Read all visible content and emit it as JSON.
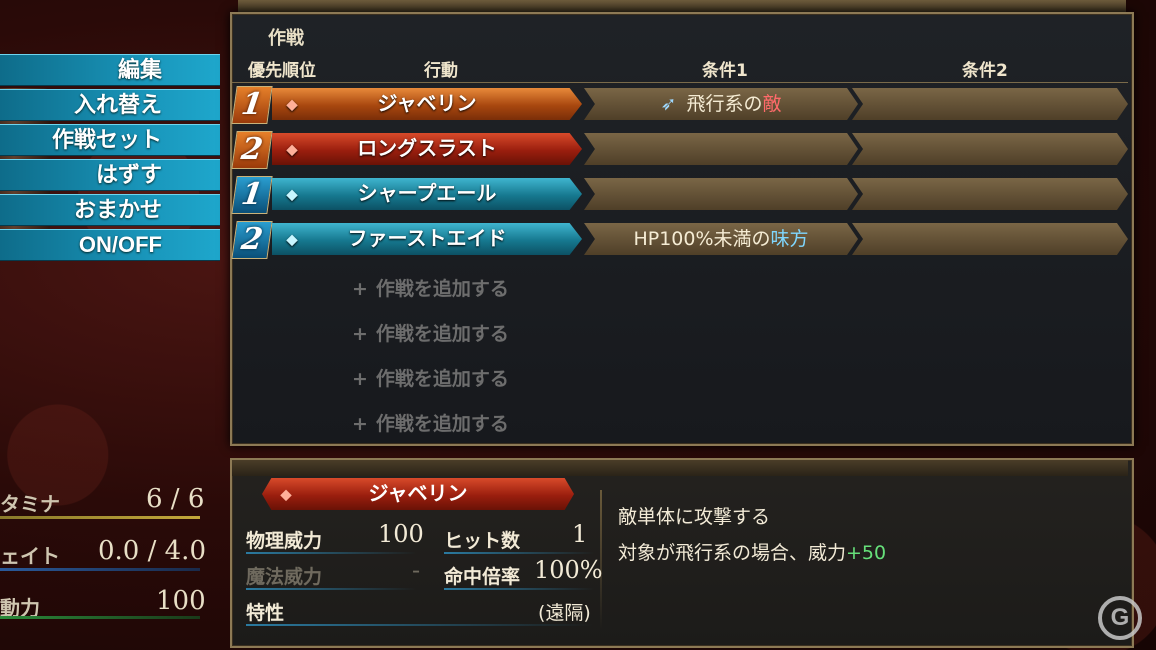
{
  "left_menu": [
    "編集",
    "入れ替え",
    "作戦セット",
    "はずす",
    "おまかせ",
    "ON/OFF"
  ],
  "panel": {
    "title": "作戦",
    "headers": {
      "priority": "優先順位",
      "action": "行動",
      "cond1": "条件1",
      "cond2": "条件2"
    }
  },
  "rows": [
    {
      "rank": "1",
      "action": "ジャベリン",
      "cond1_pre": "飛行系の",
      "cond1_hl": "敵",
      "cond2": ""
    },
    {
      "rank": "2",
      "action": "ロングスラスト",
      "cond1_pre": "",
      "cond1_hl": "",
      "cond2": ""
    },
    {
      "rank": "1",
      "action": "シャープエール",
      "cond1_pre": "",
      "cond1_hl": "",
      "cond2": ""
    },
    {
      "rank": "2",
      "action": "ファーストエイド",
      "cond1_pre": "HP100%未満の",
      "cond1_hl": "味方",
      "cond2": ""
    }
  ],
  "add_slots": [
    "作戦を追加する",
    "作戦を追加する",
    "作戦を追加する",
    "作戦を追加する"
  ],
  "add_plus": "+",
  "detail": {
    "skill_name": "ジャベリン",
    "phys_label": "物理威力",
    "phys_value": "100",
    "hits_label": "ヒット数",
    "hits_value": "1",
    "magic_label": "魔法威力",
    "magic_value": "-",
    "acc_label": "命中倍率",
    "acc_value": "100%",
    "trait_label": "特性",
    "trait_value": "(遠隔)",
    "desc_line1": "敵単体に攻撃する",
    "desc_line2_pre": "対象が飛行系の場合、威力",
    "desc_line2_hl": "+50"
  },
  "left_stats": [
    {
      "label": "タミナ",
      "value": "6 / 6"
    },
    {
      "label": "ェイト",
      "value": "0.0 / 4.0"
    },
    {
      "label": "動力",
      "value": "100"
    }
  ],
  "logo": "G",
  "colors": {
    "menu_blue": "#1a98bd",
    "gold_border": "#8d7a55",
    "enemy_red": "#ff6a6a",
    "ally_blue": "#7fd7ff",
    "bonus_green": "#66e07a"
  }
}
